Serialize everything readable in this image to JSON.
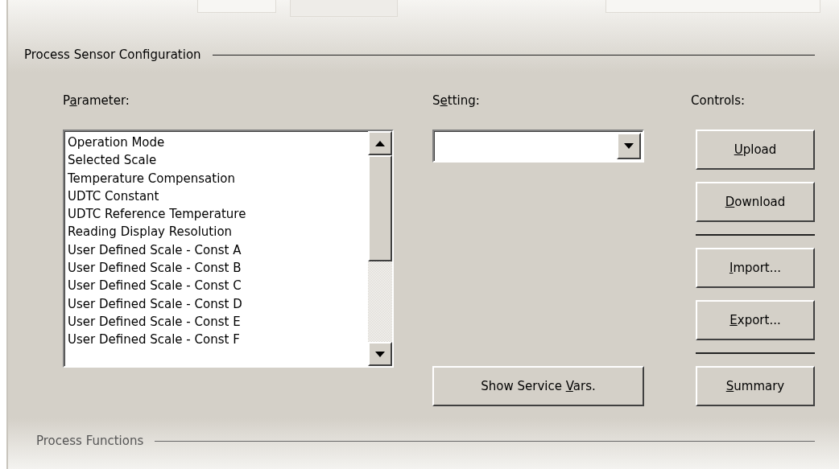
{
  "sections": [
    {
      "title": "Process Sensor Configuration",
      "dimmed": false
    },
    {
      "title": "Process Functions",
      "dimmed": true
    }
  ],
  "parameter": {
    "label": [
      {
        "text": "P",
        "underlined": false
      },
      {
        "text": "a",
        "underlined": true
      },
      {
        "text": "rameter:",
        "underlined": false
      }
    ],
    "items": [
      {
        "text": "Operation Mode"
      },
      {
        "text": "Selected Scale"
      },
      {
        "text": "Temperature Compensation"
      },
      {
        "text": "UDTC Constant"
      },
      {
        "text": "UDTC Reference Temperature"
      },
      {
        "text": "Reading Display Resolution"
      },
      {
        "text": "User Defined Scale - Const A"
      },
      {
        "text": "User Defined Scale - Const B"
      },
      {
        "text": "User Defined Scale - Const C"
      },
      {
        "text": "User Defined Scale - Const D"
      },
      {
        "text": "User Defined Scale - Const E"
      },
      {
        "text": "User Defined Scale - Const F"
      }
    ]
  },
  "setting": {
    "label": [
      {
        "text": "S",
        "underlined": false
      },
      {
        "text": "e",
        "underlined": true
      },
      {
        "text": "tting:",
        "underlined": false
      }
    ],
    "service_button": {
      "label": [
        {
          "text": "Show Service ",
          "underlined": false
        },
        {
          "text": "V",
          "underlined": true
        },
        {
          "text": "ars.",
          "underlined": false
        }
      ]
    }
  },
  "controls": {
    "label": "Controls:",
    "items": [
      {
        "kind": "button",
        "label": [
          {
            "text": "U",
            "underlined": true
          },
          {
            "text": "pload",
            "underlined": false
          }
        ]
      },
      {
        "kind": "button",
        "label": [
          {
            "text": "D",
            "underlined": true
          },
          {
            "text": "ownload",
            "underlined": false
          }
        ]
      },
      {
        "kind": "separator"
      },
      {
        "kind": "button",
        "label": [
          {
            "text": "I",
            "underlined": true
          },
          {
            "text": "mport...",
            "underlined": false
          }
        ]
      },
      {
        "kind": "button",
        "label": [
          {
            "text": "E",
            "underlined": true
          },
          {
            "text": "xport...",
            "underlined": false
          }
        ]
      },
      {
        "kind": "separator"
      },
      {
        "kind": "button",
        "label": [
          {
            "text": "S",
            "underlined": true
          },
          {
            "text": "ummary",
            "underlined": false
          }
        ]
      }
    ]
  }
}
